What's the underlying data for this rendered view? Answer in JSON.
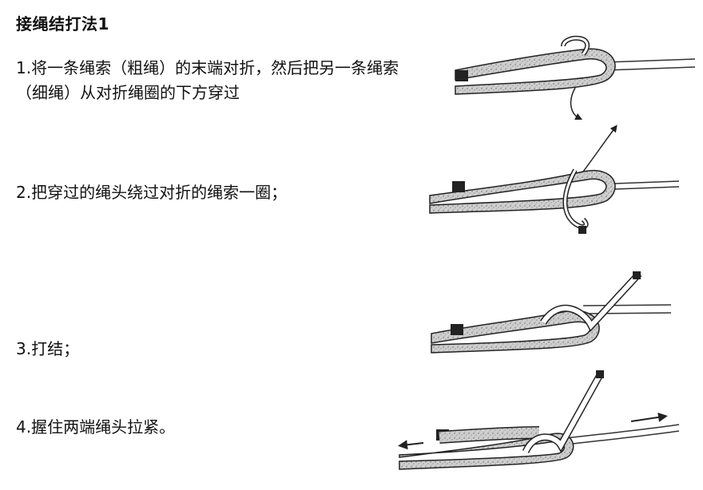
{
  "title": "接绳结打法1",
  "steps": [
    "1.将一条绳索（粗绳）的末端对折，然后把另一条绳索（细绳）从对折绳圈的下方穿过",
    "2.把穿过的绳头绕过对折的绳索一圈；",
    "3.打结；",
    "4.握住两端绳头拉紧。"
  ],
  "colors": {
    "rope_fill": "#c9c9c9",
    "rope_stroke": "#2a2a2a",
    "thin_rope": "#ffffff"
  }
}
